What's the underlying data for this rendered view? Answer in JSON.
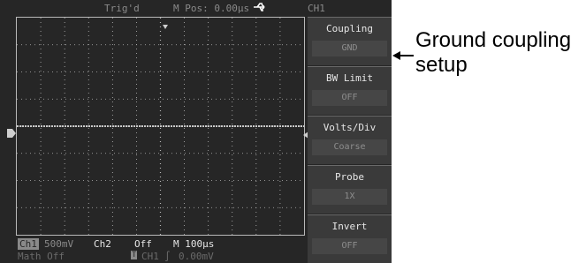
{
  "top": {
    "trigger_status": "Trig'd",
    "m_pos": "M Pos: 0.00µs",
    "usb_icon": "usb-icon"
  },
  "menu": {
    "channel": "CH1",
    "items": [
      {
        "label": "Coupling",
        "value": "GND"
      },
      {
        "label": "BW Limit",
        "value": "OFF"
      },
      {
        "label": "Volts/Div",
        "value": "Coarse"
      },
      {
        "label": "Probe",
        "value": "1X"
      },
      {
        "label": "Invert",
        "value": "OFF"
      }
    ]
  },
  "bottom": {
    "ch1_badge": "Ch1",
    "ch1_scale": "500mV",
    "ch2_label": "Ch2",
    "ch2_state": "Off",
    "timebase": "M 100µs",
    "math": "Math  Off",
    "trigger_source": "CH1",
    "trigger_slope": "∫",
    "trigger_level": "0.00mV",
    "trigger_icon": "T"
  },
  "annotation": {
    "line1": "Ground coupling",
    "line2": "setup"
  },
  "colors": {
    "screen_bg": "#262626",
    "trace": "#ffffff",
    "grid": "#b9b9b9",
    "menu_panel": "#3a3a3a"
  }
}
